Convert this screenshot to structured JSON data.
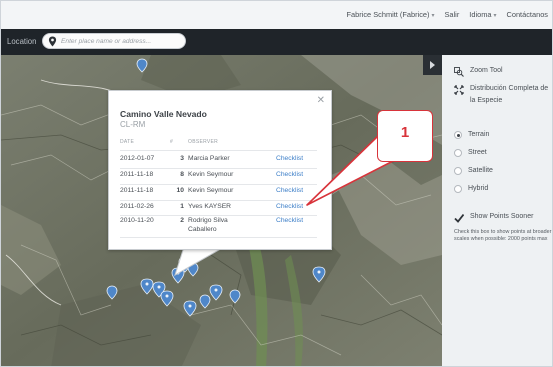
{
  "topnav": {
    "user": "Fabrice Schmitt (Fabrice)",
    "logout": "Salir",
    "language": "Idioma",
    "contact": "Contáctanos"
  },
  "locationbar": {
    "label": "Location",
    "placeholder": "Enter place name or address..."
  },
  "popup": {
    "title": "Camino Valle Nevado",
    "code": "CL-RM",
    "headers": {
      "date": "DATE",
      "count": "#",
      "observer": "OBSERVER"
    },
    "rows": [
      {
        "date": "2012-01-07",
        "count": "3",
        "observer": "Marcia Parker",
        "link": "Checklist"
      },
      {
        "date": "2011-11-18",
        "count": "8",
        "observer": "Kevin Seymour",
        "link": "Checklist"
      },
      {
        "date": "2011-11-18",
        "count": "10",
        "observer": "Kevin Seymour",
        "link": "Checklist"
      },
      {
        "date": "2011-02-26",
        "count": "1",
        "observer": "Yves KAYSER",
        "link": "Checklist"
      },
      {
        "date": "2010-11-20",
        "count": "2",
        "observer": "Rodrigo Silva Caballero",
        "observer_line1": "Rodrigo Silva",
        "observer_line2": "Caballero",
        "link": "Checklist"
      }
    ]
  },
  "callout": {
    "number": "1",
    "color": "#d8333a"
  },
  "panel": {
    "zoom_tool": "Zoom Tool",
    "distribution_line1": "Distribución Completa de",
    "distribution_line2": "la Especie",
    "map_types": [
      {
        "label": "Terrain",
        "selected": true
      },
      {
        "label": "Street",
        "selected": false
      },
      {
        "label": "Satellite",
        "selected": false
      },
      {
        "label": "Hybrid",
        "selected": false
      }
    ],
    "show_points": "Show Points Sooner",
    "hint": "Check this box to show points at broader scales when possible: 2000 points max"
  },
  "colors": {
    "link": "#3d7fc8",
    "marker": "#4f87c9",
    "dark_bar": "#1f2429"
  }
}
